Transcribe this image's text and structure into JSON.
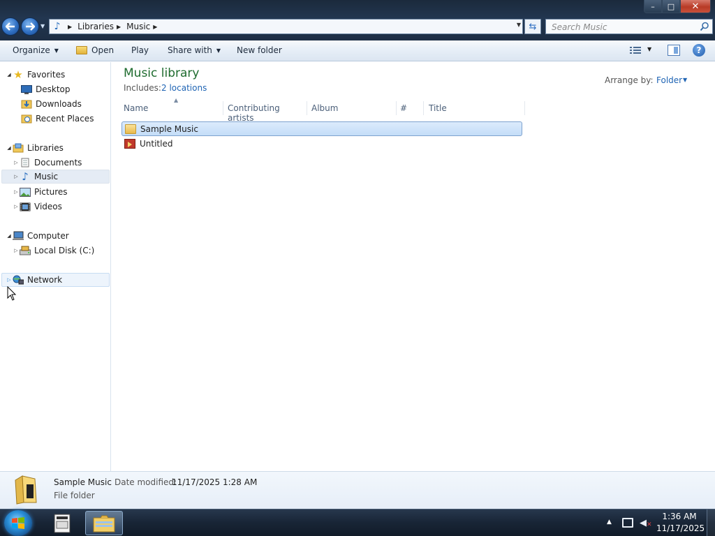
{
  "titlebar": {
    "minimize": "–",
    "maximize": "□",
    "close": "✕"
  },
  "address": {
    "crumbs": [
      "Libraries",
      "Music"
    ]
  },
  "search": {
    "placeholder": "Search Music"
  },
  "toolbar": {
    "organize": "Organize",
    "open": "Open",
    "play": "Play",
    "share_with": "Share with",
    "new_folder": "New folder"
  },
  "nav": {
    "favorites": "Favorites",
    "favorites_items": [
      "Desktop",
      "Downloads",
      "Recent Places"
    ],
    "libraries": "Libraries",
    "libraries_items": [
      "Documents",
      "Music",
      "Pictures",
      "Videos"
    ],
    "computer": "Computer",
    "computer_items": [
      "Local Disk (C:)"
    ],
    "network": "Network"
  },
  "library": {
    "title": "Music library",
    "includes_label": "Includes:",
    "includes_link": "2 locations",
    "arrange_label": "Arrange by:",
    "arrange_value": "Folder"
  },
  "columns": [
    "Name",
    "Contributing artists",
    "Album",
    "#",
    "Title"
  ],
  "files": [
    {
      "name": "Sample Music",
      "type": "folder",
      "selected": true
    },
    {
      "name": "Untitled",
      "type": "media",
      "selected": false
    }
  ],
  "details": {
    "name": "Sample Music",
    "date_label": "Date modified:",
    "date_value": "11/17/2025 1:28 AM",
    "type": "File folder"
  },
  "taskbar": {
    "time": "1:36 AM",
    "date": "11/17/2025"
  },
  "colors": {
    "library_title": "#1e6b2e",
    "link": "#1f64b4",
    "selection": "#c4ddf8"
  }
}
